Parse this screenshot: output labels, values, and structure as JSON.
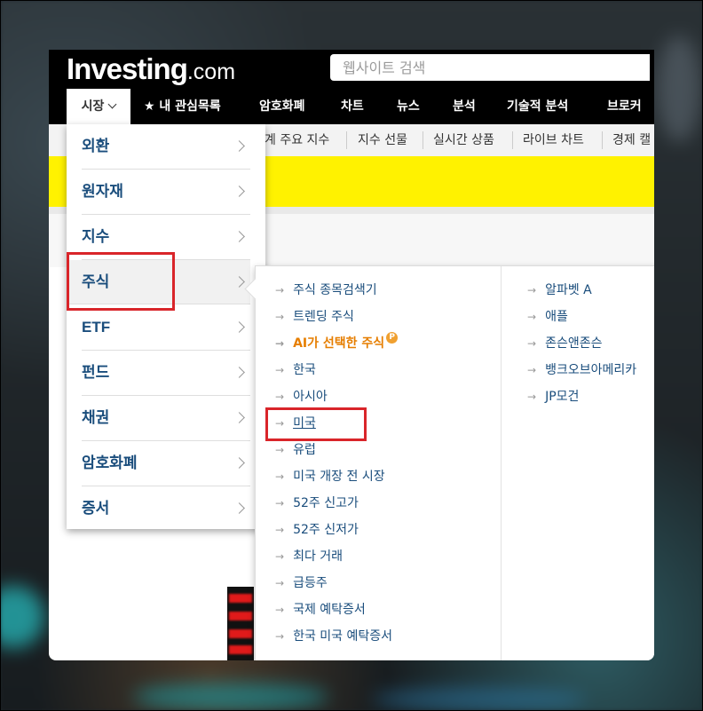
{
  "header": {
    "logo_main": "Investing",
    "logo_suffix": ".com",
    "search_placeholder": "웹사이트 검색"
  },
  "nav": {
    "items": [
      {
        "label": "시장"
      },
      {
        "label": "★ 내 관심목록"
      },
      {
        "label": "암호화폐"
      },
      {
        "label": "차트"
      },
      {
        "label": "뉴스"
      },
      {
        "label": "분석"
      },
      {
        "label": "기술적 분석"
      },
      {
        "label": "브로커"
      }
    ]
  },
  "subnav": {
    "items": [
      {
        "label": "계 주요 지수"
      },
      {
        "label": "지수 선물"
      },
      {
        "label": "실시간 상품"
      },
      {
        "label": "라이브 차트"
      },
      {
        "label": "경제 캘"
      }
    ]
  },
  "markets_menu": {
    "items": [
      {
        "label": "외환"
      },
      {
        "label": "원자재"
      },
      {
        "label": "지수"
      },
      {
        "label": "주식"
      },
      {
        "label": "ETF"
      },
      {
        "label": "펀드"
      },
      {
        "label": "채권"
      },
      {
        "label": "암호화폐"
      },
      {
        "label": "증서"
      }
    ],
    "highlighted": "주식"
  },
  "stocks_submenu": {
    "arrow": "→",
    "left_items": [
      {
        "label": "주식 종목검색기"
      },
      {
        "label": "트렌딩 주식"
      },
      {
        "label": "AI가 선택한 주식",
        "badge": "P"
      },
      {
        "label": "한국"
      },
      {
        "label": "아시아"
      },
      {
        "label": "미국"
      },
      {
        "label": "유럽"
      },
      {
        "label": "미국 개장 전 시장"
      },
      {
        "label": "52주 신고가"
      },
      {
        "label": "52주 신저가"
      },
      {
        "label": "최다 거래"
      },
      {
        "label": "급등주"
      },
      {
        "label": "국제 예탁증서"
      },
      {
        "label": "한국 미국 예탁증서"
      }
    ],
    "right_items": [
      {
        "label": "알파벳 A"
      },
      {
        "label": "애플"
      },
      {
        "label": "존슨앤존슨"
      },
      {
        "label": "뱅크오브아메리카"
      },
      {
        "label": "JP모건"
      }
    ]
  },
  "colors": {
    "accent_orange": "#e67e00",
    "link_blue": "#1a4d7c",
    "highlight_red": "#d9252a",
    "banner_yellow": "#fff200"
  }
}
